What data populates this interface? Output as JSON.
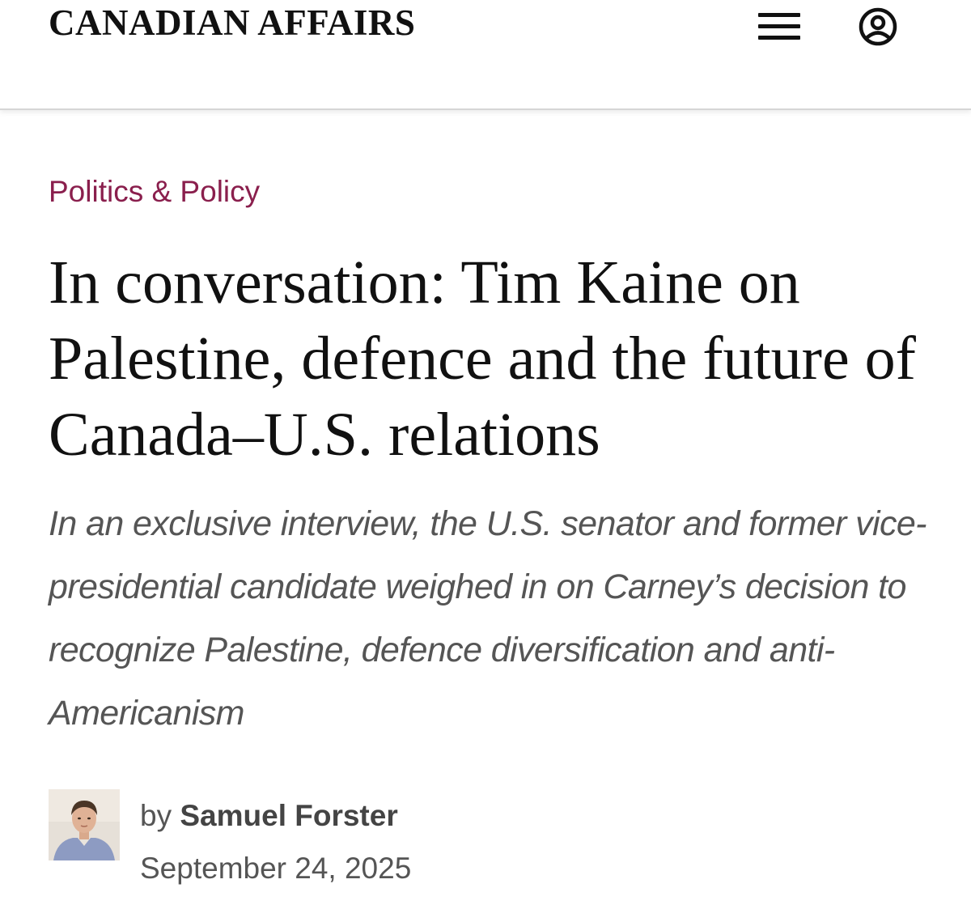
{
  "header": {
    "brand": "CANADIAN AFFAIRS",
    "menu_icon": "hamburger-menu-icon",
    "account_icon": "user-account-icon"
  },
  "article": {
    "category": "Politics & Policy",
    "headline": "In conversation: Tim Kaine on Palestine, defence and the future of Canada–U.S. relations",
    "dek": "In an exclusive interview, the U.S. senator and former vice-presidential candidate weighed in on Carney’s decision to recognize Palestine, defence diversification and anti-Americanism",
    "byline": {
      "prefix": "by",
      "author": "Samuel Forster",
      "date": "September 24, 2025",
      "avatar_icon": "author-photo"
    }
  },
  "colors": {
    "category": "#8a1f4d",
    "headline": "#111111",
    "dek": "#555555",
    "header_border": "#d6d6d6"
  }
}
